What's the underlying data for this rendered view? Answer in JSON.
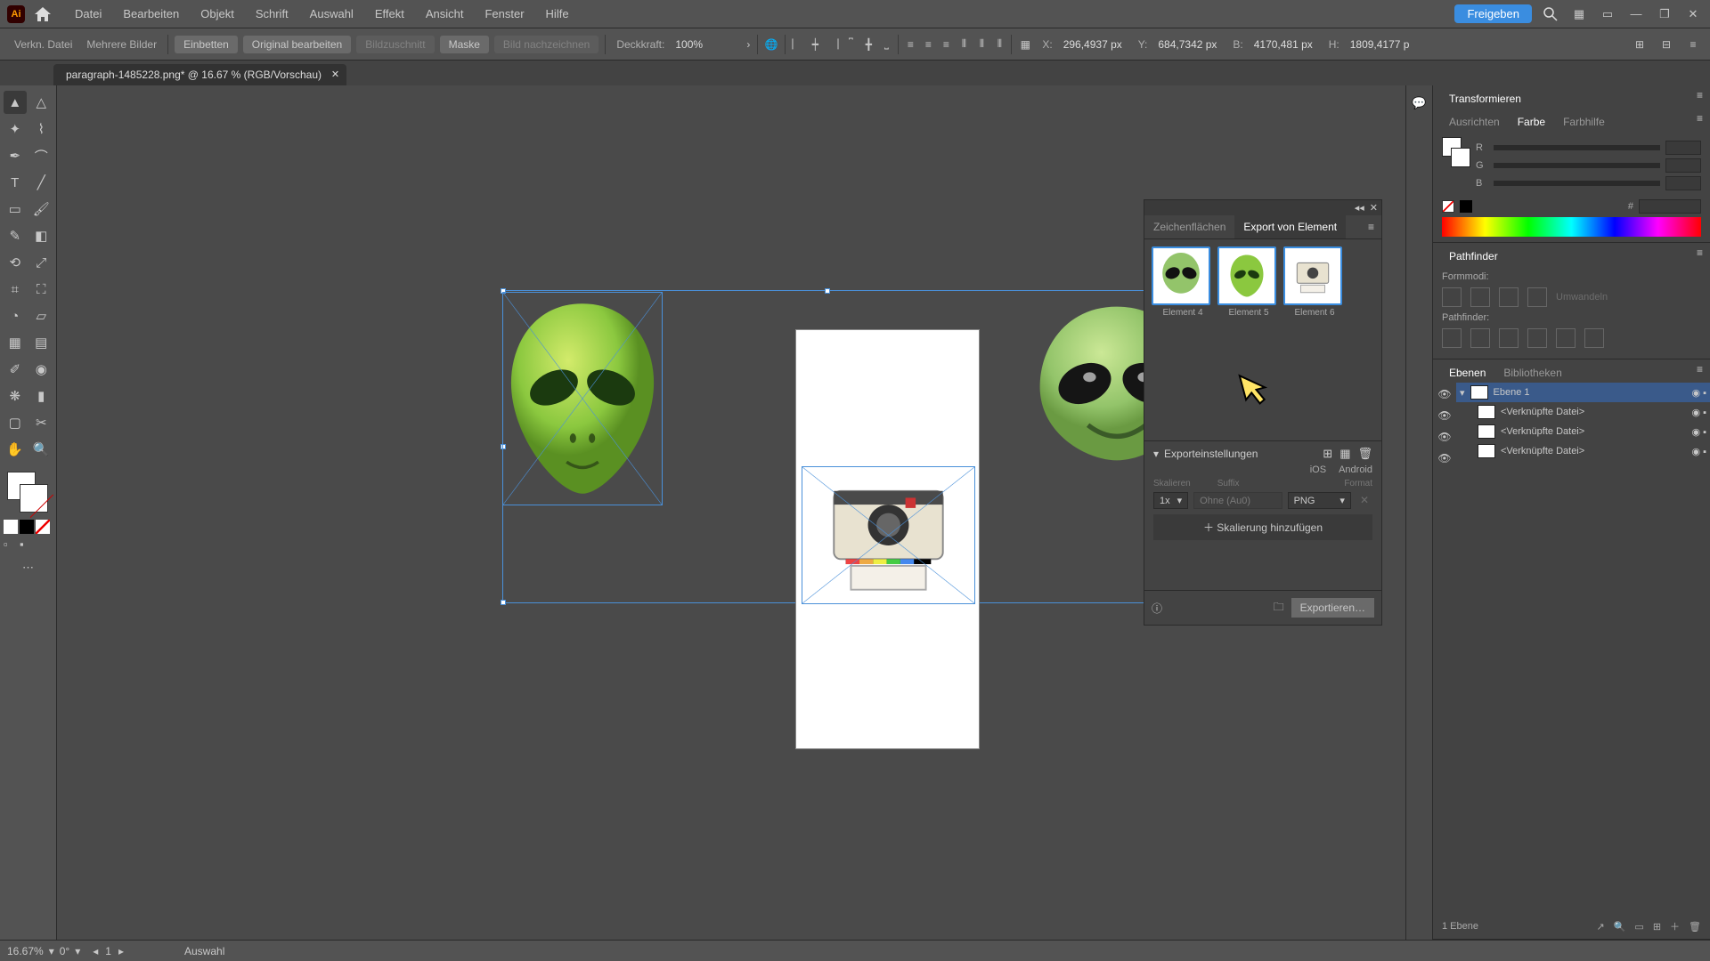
{
  "app": {
    "logo": "Ai"
  },
  "menubar": {
    "items": [
      "Datei",
      "Bearbeiten",
      "Objekt",
      "Schrift",
      "Auswahl",
      "Effekt",
      "Ansicht",
      "Fenster",
      "Hilfe"
    ],
    "share": "Freigeben"
  },
  "optionsbar": {
    "label1": "Verkn. Datei",
    "label2": "Mehrere Bilder",
    "btn_embed": "Einbetten",
    "btn_original": "Original bearbeiten",
    "btn_crop": "Bildzuschnitt",
    "btn_mask": "Maske",
    "btn_trace": "Bild nachzeichnen",
    "opacity_label": "Deckkraft:",
    "opacity_value": "100%",
    "x_label": "X:",
    "x_value": "296,4937 px",
    "y_label": "Y:",
    "y_value": "684,7342 px",
    "w_label": "B:",
    "w_value": "4170,481 px",
    "h_label": "H:",
    "h_value": "1809,4177 p"
  },
  "tab": {
    "title": "paragraph-1485228.png* @ 16.67 % (RGB/Vorschau)"
  },
  "export_panel": {
    "tab1": "Zeichenflächen",
    "tab2": "Export von Element",
    "thumbs": [
      {
        "label": "Element 4"
      },
      {
        "label": "Element 5"
      },
      {
        "label": "Element 6"
      }
    ],
    "settings_label": "Exporteinstellungen",
    "plat_ios": "iOS",
    "plat_android": "Android",
    "col_scale": "Skalieren",
    "col_suffix": "Suffix",
    "col_format": "Format",
    "scale_value": "1x",
    "suffix_value": "Ohne (Au0)",
    "format_value": "PNG",
    "add_scale": "Skalierung hinzufügen",
    "export_btn": "Exportieren…"
  },
  "right": {
    "transform_tab": "Transformieren",
    "align_tab": "Ausrichten",
    "color_tab": "Farbe",
    "guide_tab": "Farbhilfe",
    "r": "R",
    "g": "G",
    "b": "B",
    "hex": "#",
    "pathfinder_label": "Pathfinder",
    "formmodi": "Formmodi:",
    "pathfinder2": "Pathfinder:",
    "expand": "Umwandeln",
    "layers_tab": "Ebenen",
    "libs_tab": "Bibliotheken",
    "layer1": "Ebene 1",
    "linked": "<Verknüpfte Datei>",
    "layer_count": "1 Ebene"
  },
  "status": {
    "zoom": "16.67%",
    "angle": "0°",
    "artb": "1",
    "tool": "Auswahl"
  }
}
